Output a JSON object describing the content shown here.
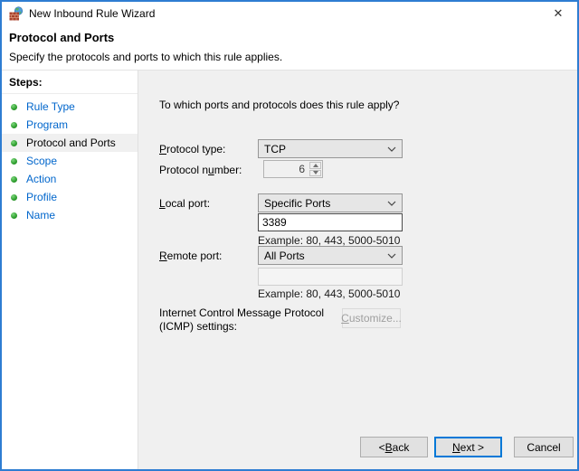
{
  "window": {
    "title": "New Inbound Rule Wizard",
    "close_glyph": "✕"
  },
  "header": {
    "title": "Protocol and Ports",
    "subtitle": "Specify the protocols and ports to which this rule applies."
  },
  "sidebar": {
    "heading": "Steps:",
    "steps": [
      {
        "label": "Rule Type",
        "active": false
      },
      {
        "label": "Program",
        "active": false
      },
      {
        "label": "Protocol and Ports",
        "active": true
      },
      {
        "label": "Scope",
        "active": false
      },
      {
        "label": "Action",
        "active": false
      },
      {
        "label": "Profile",
        "active": false
      },
      {
        "label": "Name",
        "active": false
      }
    ]
  },
  "content": {
    "question": "To which ports and protocols does this rule apply?",
    "protocol_type": {
      "label": "&Protocol type:",
      "value": "TCP"
    },
    "protocol_number": {
      "label": "Protocol n&umber:",
      "value": "6"
    },
    "local_port": {
      "label": "&Local port:",
      "value": "Specific Ports",
      "ports": "3389",
      "example": "Example: 80, 443, 5000-5010"
    },
    "remote_port": {
      "label": "&Remote port:",
      "value": "All Ports",
      "ports": "",
      "example": "Example: 80, 443, 5000-5010"
    },
    "icmp": {
      "line1": "Internet Control Message Protocol",
      "line2": "(ICMP) settings:",
      "button": "&Customize..."
    }
  },
  "buttons": {
    "back": "< &Back",
    "next": "&Next >",
    "cancel": "Cancel"
  },
  "colors": {
    "accent": "#2e7dd2",
    "accent2": "#0078d7",
    "link": "#0066cc",
    "green": "#2e9e2e"
  }
}
